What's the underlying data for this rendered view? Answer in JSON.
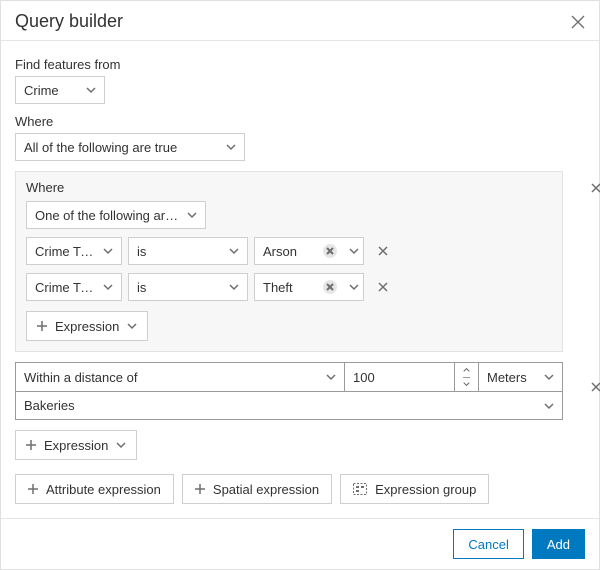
{
  "dialog": {
    "title": "Query builder",
    "find_label": "Find features from",
    "layer": "Crime",
    "where_label": "Where",
    "logical_operator": "All of the following are true"
  },
  "group1": {
    "where_label": "Where",
    "logical_operator": "One of the following are tr…",
    "rows": [
      {
        "field": "Crime Type",
        "op": "is",
        "value": "Arson"
      },
      {
        "field": "Crime Type",
        "op": "is",
        "value": "Theft"
      }
    ],
    "expression_btn": "Expression"
  },
  "spatial": {
    "relationship": "Within a distance of",
    "distance": "100",
    "unit": "Meters",
    "target_layer": "Bakeries",
    "expression_btn": "Expression"
  },
  "add_buttons": {
    "attribute": "Attribute expression",
    "spatial": "Spatial expression",
    "group": "Expression group"
  },
  "footer": {
    "cancel": "Cancel",
    "add": "Add"
  }
}
